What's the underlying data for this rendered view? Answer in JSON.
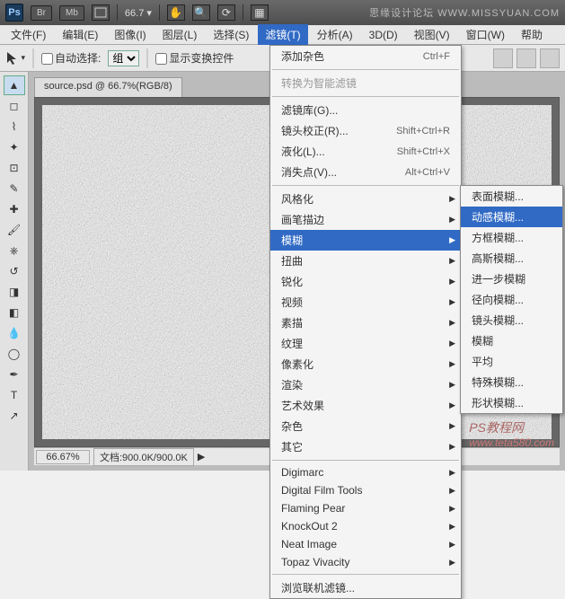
{
  "titlebar": {
    "ps": "Ps",
    "br": "Br",
    "mb": "Mb",
    "zoom": "66.7",
    "brand": "思缘设计论坛  WWW.MISSYUAN.COM"
  },
  "menubar": {
    "items": [
      "文件(F)",
      "编辑(E)",
      "图像(I)",
      "图层(L)",
      "选择(S)",
      "滤镜(T)",
      "分析(A)",
      "3D(D)",
      "视图(V)",
      "窗口(W)",
      "帮助"
    ],
    "open_index": 5
  },
  "optionsbar": {
    "auto_select_label": "自动选择:",
    "group_select": "组",
    "show_transform_label": "显示变换控件"
  },
  "document": {
    "tab": "source.psd @ 66.7%(RGB/8)",
    "zoom": "66.67%",
    "doc_info": "文档:900.0K/900.0K"
  },
  "filter_menu": {
    "last_filter": {
      "label": "添加杂色",
      "shortcut": "Ctrl+F"
    },
    "convert_smart": "转换为智能滤镜",
    "group1": [
      {
        "label": "滤镜库(G)..."
      },
      {
        "label": "镜头校正(R)...",
        "shortcut": "Shift+Ctrl+R"
      },
      {
        "label": "液化(L)...",
        "shortcut": "Shift+Ctrl+X"
      },
      {
        "label": "消失点(V)...",
        "shortcut": "Alt+Ctrl+V"
      }
    ],
    "group2": [
      "风格化",
      "画笔描边",
      "模糊",
      "扭曲",
      "锐化",
      "视频",
      "素描",
      "纹理",
      "像素化",
      "渲染",
      "艺术效果",
      "杂色",
      "其它"
    ],
    "highlight_index": 2,
    "group3": [
      "Digimarc",
      "Digital Film Tools",
      "Flaming Pear",
      "KnockOut 2",
      "Neat Image",
      "Topaz Vivacity"
    ],
    "browse": "浏览联机滤镜..."
  },
  "blur_submenu": {
    "items": [
      "表面模糊...",
      "动感模糊...",
      "方框模糊...",
      "高斯模糊...",
      "进一步模糊",
      "径向模糊...",
      "镜头模糊...",
      "模糊",
      "平均",
      "特殊模糊...",
      "形状模糊..."
    ],
    "highlight_index": 1
  },
  "watermark": {
    "text": "www.teta580.com",
    "label": "PS教程网"
  }
}
